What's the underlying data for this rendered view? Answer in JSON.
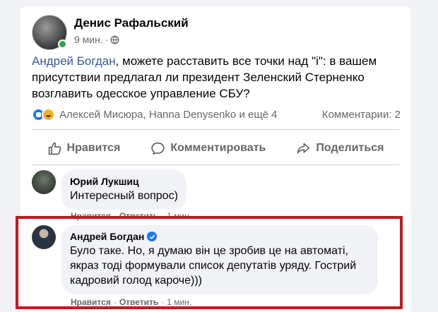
{
  "post": {
    "author": "Денис Рафальский",
    "time": "9 мин.",
    "dot": "·",
    "text_mention": "Андрей Богдан",
    "text_rest": ", можете расставить все точки над \"і\": в вашем присутствии предлагал ли президент Зеленский Стерненко возглавить одесское управление СБУ?"
  },
  "reactions": {
    "names": "Алексей Мисюра, Hanna Denysenko и ещё 4",
    "comments_count": "Комментарии: 2"
  },
  "actions": {
    "like": "Нравится",
    "comment": "Комментировать",
    "share": "Поделиться"
  },
  "comments": [
    {
      "name": "Юрий Лукшиц",
      "text": "Интересный вопрос)",
      "like": "Нравится",
      "reply": "Ответить",
      "time": "1 мин."
    },
    {
      "name": "Андрей Богдан",
      "text": "Було таке. Но, я думаю він це зробив це на автоматі, якраз тоді формували список депутатів уряду. Гострий кадровий голод кароче)))",
      "like": "Нравится",
      "reply": "Ответить",
      "time": "1 мин."
    }
  ],
  "colors": {
    "accent": "#1877f2",
    "highlight": "#c6181f",
    "mention": "#385898"
  }
}
